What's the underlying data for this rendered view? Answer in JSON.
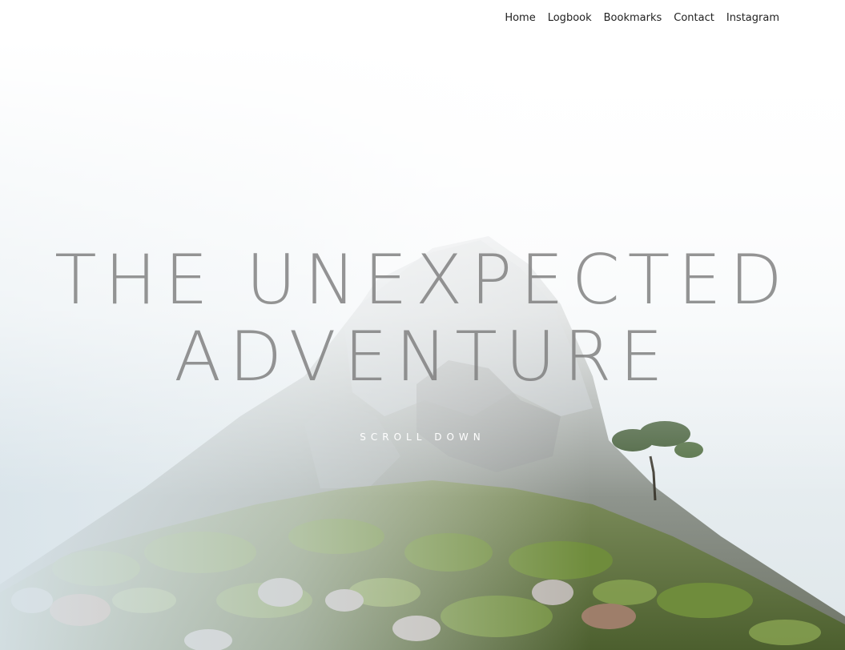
{
  "nav": {
    "items": [
      {
        "label": "Home"
      },
      {
        "label": "Logbook"
      },
      {
        "label": "Bookmarks"
      },
      {
        "label": "Contact"
      },
      {
        "label": "Instagram"
      }
    ]
  },
  "hero": {
    "title_line1": "THE UNEXPECTED",
    "title_line2": "ADVENTURE",
    "scroll_label": "SCROLL DOWN"
  },
  "colors": {
    "title": "#7d7d7d",
    "nav_text": "#222222",
    "fog": "#e9eff2",
    "rock": "#8c8f8a",
    "vegetation": "#5f7a3a"
  }
}
